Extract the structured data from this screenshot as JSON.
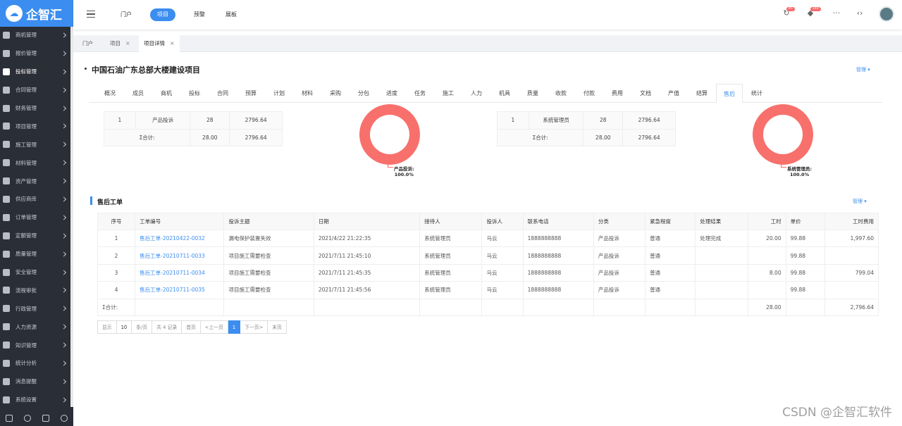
{
  "logo": {
    "text": "企智汇"
  },
  "sidebar": {
    "items": [
      {
        "label": "商机管理"
      },
      {
        "label": "报价管理"
      },
      {
        "label": "投标管理"
      },
      {
        "label": "合同管理"
      },
      {
        "label": "财务管理"
      },
      {
        "label": "项目管理"
      },
      {
        "label": "施工管理"
      },
      {
        "label": "材料管理"
      },
      {
        "label": "资产管理"
      },
      {
        "label": "供应商库"
      },
      {
        "label": "订单管理"
      },
      {
        "label": "定额管理"
      },
      {
        "label": "质量管理"
      },
      {
        "label": "安全管理"
      },
      {
        "label": "流程审批"
      },
      {
        "label": "行政管理"
      },
      {
        "label": "人力资源"
      },
      {
        "label": "知识管理"
      },
      {
        "label": "统计分析"
      },
      {
        "label": "消息提醒"
      },
      {
        "label": "系统设置"
      }
    ]
  },
  "header": {
    "nav": [
      {
        "label": "门户"
      },
      {
        "label": "项目"
      },
      {
        "label": "预警"
      },
      {
        "label": "展板"
      }
    ],
    "badge1": "45",
    "badge2": "140"
  },
  "page_tabs": [
    {
      "label": "门户"
    },
    {
      "label": "项目"
    },
    {
      "label": "项目详情"
    }
  ],
  "project": {
    "title": "中国石油广东总部大楼建设项目",
    "manage": "管理",
    "tabs": [
      "概况",
      "成员",
      "商机",
      "投标",
      "合同",
      "预算",
      "计划",
      "材料",
      "采购",
      "分包",
      "进度",
      "任务",
      "施工",
      "人力",
      "机具",
      "质量",
      "收款",
      "付款",
      "费用",
      "文档",
      "产值",
      "结算",
      "售后",
      "统计"
    ],
    "active_tab": "售后"
  },
  "summary_left": {
    "row": {
      "no": "1",
      "name": "产品投诉",
      "count": "28",
      "amount": "2796.64"
    },
    "total": {
      "label": "Σ合计:",
      "count": "28.00",
      "amount": "2796.64"
    }
  },
  "summary_right": {
    "row": {
      "no": "1",
      "name": "系统管理员",
      "count": "28",
      "amount": "2796.64"
    },
    "total": {
      "label": "Σ合计:",
      "count": "28.00",
      "amount": "2796.64"
    }
  },
  "chart_data": [
    {
      "type": "pie",
      "categories": [
        "产品投诉"
      ],
      "values": [
        100.0
      ],
      "labels": [
        "产品投诉:",
        "100.0%"
      ]
    },
    {
      "type": "pie",
      "categories": [
        "系统管理员"
      ],
      "values": [
        100.0
      ],
      "labels": [
        "系统管理员:",
        "100.0%"
      ]
    }
  ],
  "section": {
    "title": "售后工单",
    "manage": "管理",
    "columns": [
      "序号",
      "工单编号",
      "投诉主题",
      "日期",
      "接待人",
      "投诉人",
      "联系电话",
      "分类",
      "紧急程度",
      "处理结果",
      "工时",
      "单价",
      "工时费用"
    ],
    "rows": [
      {
        "no": "1",
        "code": "售后工单-20210422-0032",
        "subject": "漏电保护装置失效",
        "date": "2021/4/22 21:22:35",
        "receiver": "系统管理员",
        "complainant": "马云",
        "phone": "1888888888",
        "category": "产品投诉",
        "urgency": "普通",
        "result": "处理完成",
        "hours": "20.00",
        "price": "99.88",
        "fee": "1,997.60"
      },
      {
        "no": "2",
        "code": "售后工单-20210711-0033",
        "subject": "项目施工需要检查",
        "date": "2021/7/11 21:45:10",
        "receiver": "系统管理员",
        "complainant": "马云",
        "phone": "1888888888",
        "category": "产品投诉",
        "urgency": "普通",
        "result": "",
        "hours": "",
        "price": "99.88",
        "fee": ""
      },
      {
        "no": "3",
        "code": "售后工单-20210711-0034",
        "subject": "项目施工需要检查",
        "date": "2021/7/11 21:45:35",
        "receiver": "系统管理员",
        "complainant": "马云",
        "phone": "1888888888",
        "category": "产品投诉",
        "urgency": "普通",
        "result": "",
        "hours": "8.00",
        "price": "99.88",
        "fee": "799.04"
      },
      {
        "no": "4",
        "code": "售后工单-20210711-0035",
        "subject": "项目施工需要检查",
        "date": "2021/7/11 21:45:56",
        "receiver": "系统管理员",
        "complainant": "马云",
        "phone": "1888888888",
        "category": "产品投诉",
        "urgency": "普通",
        "result": "",
        "hours": "",
        "price": "99.88",
        "fee": ""
      }
    ],
    "total": {
      "label": "Σ合计:",
      "hours": "28.00",
      "fee": "2,796.64"
    }
  },
  "pager": {
    "show": "显示",
    "size": "10",
    "per": "条/页",
    "total": "共 4 记录",
    "first": "首页",
    "prev": "<上一页",
    "current": "1",
    "next": "下一页>",
    "last": "末页"
  },
  "watermark": "CSDN @企智汇软件"
}
